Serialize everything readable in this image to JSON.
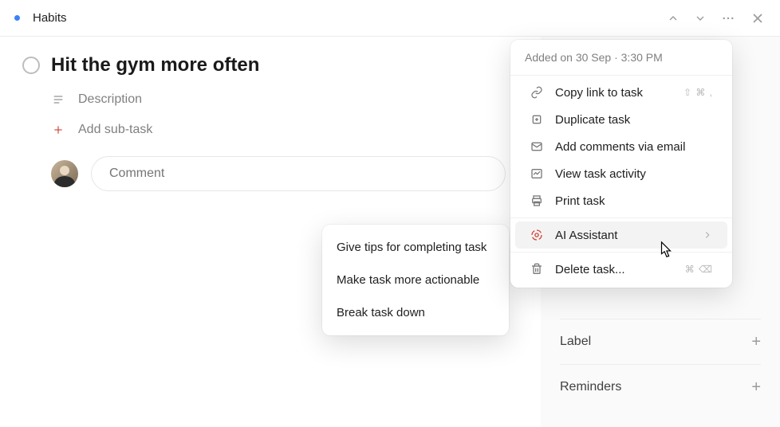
{
  "header": {
    "breadcrumb": "Habits"
  },
  "task": {
    "title": "Hit the gym more often",
    "description_label": "Description",
    "add_subtask_label": "Add sub-task",
    "comment_placeholder": "Comment"
  },
  "sidebar": {
    "label": "Label",
    "reminders": "Reminders"
  },
  "context_menu": {
    "added": "Added on 30 Sep · 3:30 PM",
    "items": {
      "copy_link": {
        "label": "Copy link to task",
        "shortcut": "⇧ ⌘ ,"
      },
      "duplicate": {
        "label": "Duplicate task"
      },
      "add_comments_email": {
        "label": "Add comments via email"
      },
      "view_activity": {
        "label": "View task activity"
      },
      "print": {
        "label": "Print task"
      },
      "ai_assistant": {
        "label": "AI Assistant"
      },
      "delete": {
        "label": "Delete task...",
        "shortcut": "⌘ ⌫"
      }
    }
  },
  "submenu": {
    "tips": "Give tips for completing task",
    "actionable": "Make task more actionable",
    "breakdown": "Break task down"
  }
}
